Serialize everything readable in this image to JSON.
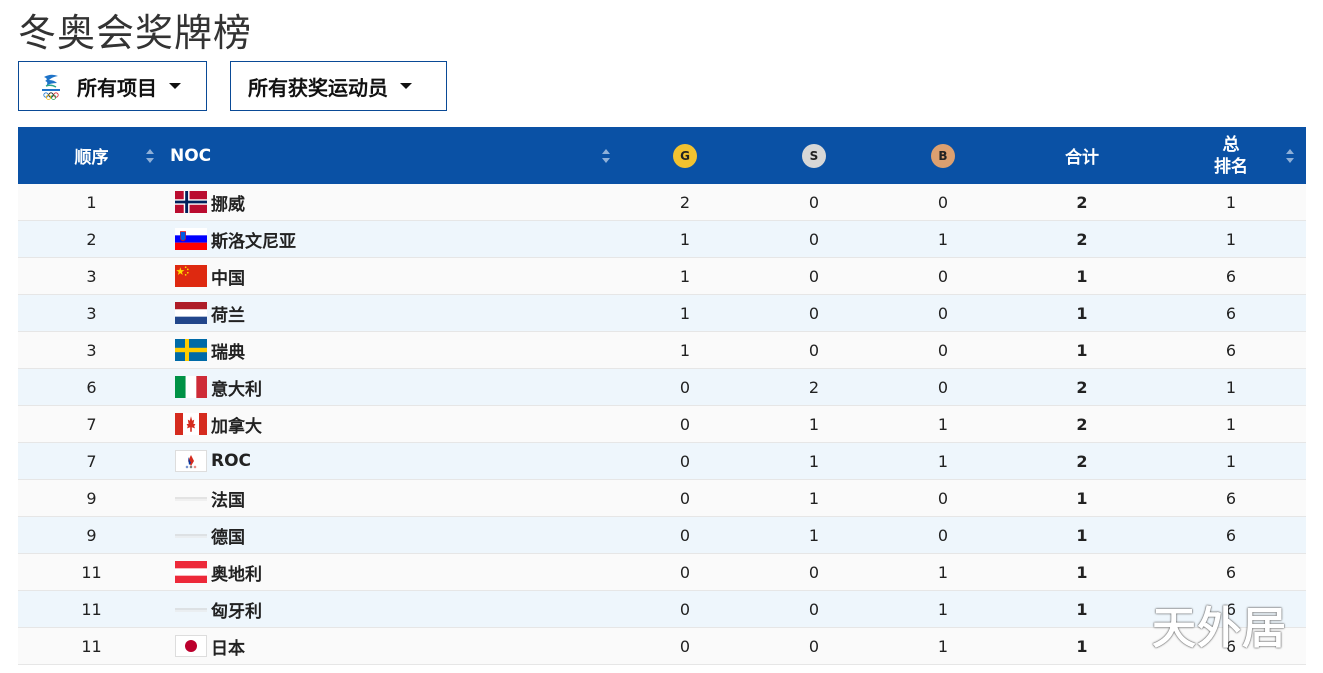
{
  "title": "冬奥会奖牌榜",
  "filters": {
    "events_label": "所有项目",
    "athletes_label": "所有获奖运动员"
  },
  "table": {
    "headers": {
      "rank": "顺序",
      "noc": "NOC",
      "gold": "G",
      "silver": "S",
      "bronze": "B",
      "total": "合计",
      "overall_line1": "总",
      "overall_line2": "排名"
    },
    "rows": [
      {
        "rank": "1",
        "noc": "挪威",
        "flag": "norway-flag",
        "gold": "2",
        "silver": "0",
        "bronze": "0",
        "total": "2",
        "overall": "1"
      },
      {
        "rank": "2",
        "noc": "斯洛文尼亚",
        "flag": "slovenia-flag",
        "gold": "1",
        "silver": "0",
        "bronze": "1",
        "total": "2",
        "overall": "1"
      },
      {
        "rank": "3",
        "noc": "中国",
        "flag": "china-flag",
        "gold": "1",
        "silver": "0",
        "bronze": "0",
        "total": "1",
        "overall": "6"
      },
      {
        "rank": "3",
        "noc": "荷兰",
        "flag": "netherlands-flag",
        "gold": "1",
        "silver": "0",
        "bronze": "0",
        "total": "1",
        "overall": "6"
      },
      {
        "rank": "3",
        "noc": "瑞典",
        "flag": "sweden-flag",
        "gold": "1",
        "silver": "0",
        "bronze": "0",
        "total": "1",
        "overall": "6"
      },
      {
        "rank": "6",
        "noc": "意大利",
        "flag": "italy-flag",
        "gold": "0",
        "silver": "2",
        "bronze": "0",
        "total": "2",
        "overall": "1"
      },
      {
        "rank": "7",
        "noc": "加拿大",
        "flag": "canada-flag",
        "gold": "0",
        "silver": "1",
        "bronze": "1",
        "total": "2",
        "overall": "1"
      },
      {
        "rank": "7",
        "noc": "ROC",
        "flag": "roc-emblem",
        "gold": "0",
        "silver": "1",
        "bronze": "1",
        "total": "2",
        "overall": "1"
      },
      {
        "rank": "9",
        "noc": "法国",
        "flag": "missing-flag",
        "gold": "0",
        "silver": "1",
        "bronze": "0",
        "total": "1",
        "overall": "6"
      },
      {
        "rank": "9",
        "noc": "德国",
        "flag": "missing-flag",
        "gold": "0",
        "silver": "1",
        "bronze": "0",
        "total": "1",
        "overall": "6"
      },
      {
        "rank": "11",
        "noc": "奥地利",
        "flag": "austria-flag",
        "gold": "0",
        "silver": "0",
        "bronze": "1",
        "total": "1",
        "overall": "6"
      },
      {
        "rank": "11",
        "noc": "匈牙利",
        "flag": "missing-flag",
        "gold": "0",
        "silver": "0",
        "bronze": "1",
        "total": "1",
        "overall": "6"
      },
      {
        "rank": "11",
        "noc": "日本",
        "flag": "japan-flag",
        "gold": "0",
        "silver": "0",
        "bronze": "1",
        "total": "1",
        "overall": "6"
      }
    ]
  },
  "watermark": "天外居",
  "colors": {
    "header_bg": "#0a51a5",
    "border_accent": "#0a4a96",
    "gold": "#f2c230",
    "silver": "#d7d7d7",
    "bronze": "#dca070",
    "row_alt": "#eef6fc"
  }
}
